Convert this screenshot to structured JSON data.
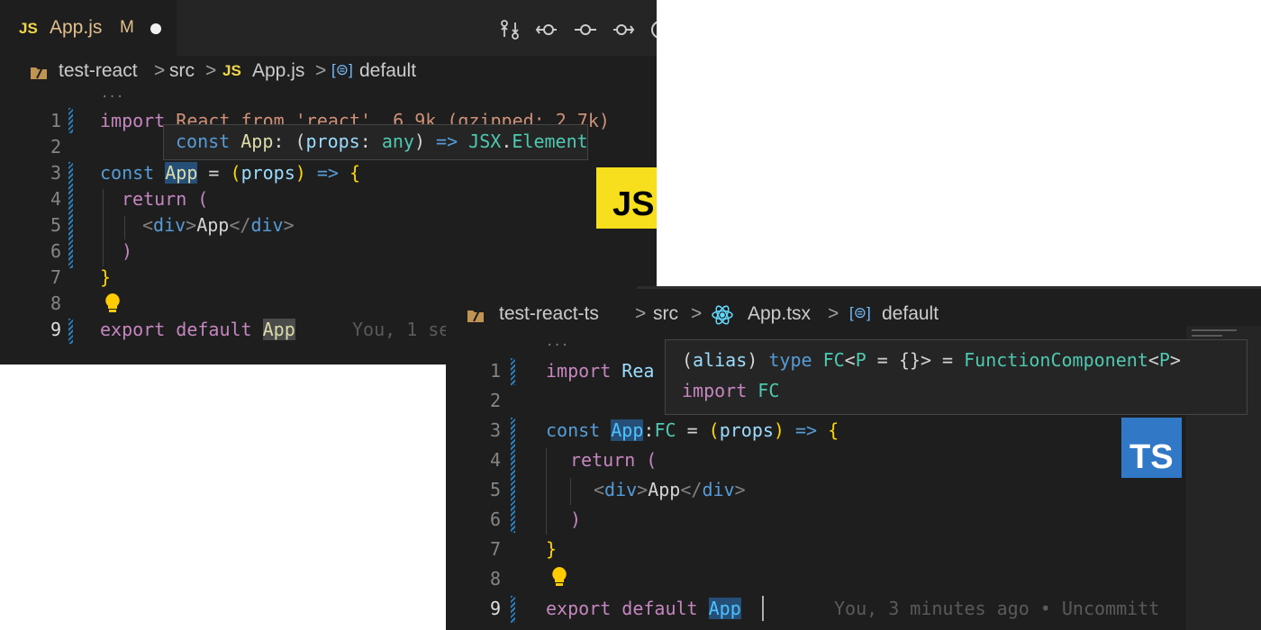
{
  "js_editor": {
    "tab": {
      "lang_glyph": "JS",
      "filename": "App.js",
      "status": "M"
    },
    "breadcrumb": {
      "project": "test-react",
      "sep": ">",
      "folder": "src",
      "lang_glyph": "JS",
      "file": "App.js",
      "symbol_icon": "[⊜]",
      "symbol": "default"
    },
    "ellipsis": "...",
    "line_numbers": [
      "1",
      "2",
      "3",
      "4",
      "5",
      "6",
      "7",
      "8",
      "9"
    ],
    "code": {
      "l1_import": "import",
      "l1_rest": " React from 'react'  6.9k (gzipped: 2.7k)",
      "l3_const": "const",
      "l3_name": "App",
      "l3_eq": " = ",
      "l3_open": "(",
      "l3_param": "props",
      "l3_close": ")",
      "l3_arrow": " => ",
      "l3_brace": "{",
      "l4_return": "return",
      "l4_paren": " (",
      "l5_lt": "<",
      "l5_tag": "div",
      "l5_gt": ">",
      "l5_text": "App",
      "l5_lt2": "</",
      "l5_tag2": "div",
      "l5_gt2": ">",
      "l6_paren": ")",
      "l7_brace": "}",
      "l9_export": "export",
      "l9_default": " default ",
      "l9_name": "App"
    },
    "blame": "You, 1 se",
    "hover": {
      "kw": "const",
      "name": "App",
      "colon": ": (",
      "param": "props",
      "colon2": ": ",
      "type": "any",
      "close": ") ",
      "arrow": "=>",
      "ns": " JSX",
      "dot": ".",
      "ret": "Element"
    },
    "badge": "JS",
    "badge_color": "#f7df1e"
  },
  "ts_editor": {
    "breadcrumb": {
      "project": "test-react-ts",
      "sep": ">",
      "folder": "src",
      "file": "App.tsx",
      "symbol_icon": "[⊜]",
      "symbol": "default"
    },
    "ellipsis": "...",
    "line_numbers": [
      "1",
      "2",
      "3",
      "4",
      "5",
      "6",
      "7",
      "8",
      "9"
    ],
    "code": {
      "l1_import": "import",
      "l1_rest": " Rea",
      "l3_const": "const",
      "l3_name": "App",
      "l3_colon": ":",
      "l3_type": "FC",
      "l3_eq": " = ",
      "l3_open": "(",
      "l3_param": "props",
      "l3_close": ")",
      "l3_arrow": " => ",
      "l3_brace": "{",
      "l4_return": "return",
      "l4_paren": " (",
      "l5_lt": "<",
      "l5_tag": "div",
      "l5_gt": ">",
      "l5_text": "App",
      "l5_lt2": "</",
      "l5_tag2": "div",
      "l5_gt2": ">",
      "l6_paren": ")",
      "l7_brace": "}",
      "l9_export": "export",
      "l9_default": " default ",
      "l9_name": "App"
    },
    "blame": "You, 3 minutes ago • Uncommitt",
    "hover": {
      "l1_open": "(",
      "l1_alias": "alias",
      "l1_close": ") ",
      "l1_type_kw": "type",
      "l1_fc": " FC",
      "l1_lt": "<",
      "l1_p": "P",
      "l1_default": " = {}> = ",
      "l1_target": "FunctionComponent",
      "l1_lt2": "<",
      "l1_p2": "P",
      "l1_gt2": ">",
      "l2_import": "import",
      "l2_fc": " FC"
    },
    "badge": "TS",
    "badge_color": "#3178c6"
  }
}
